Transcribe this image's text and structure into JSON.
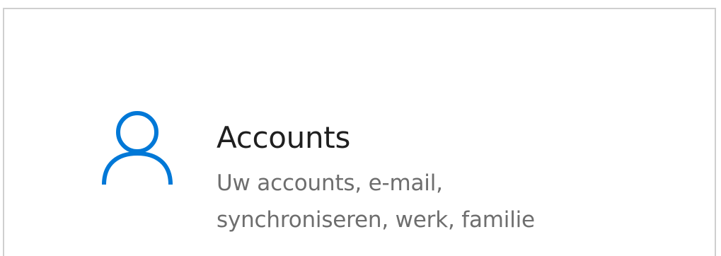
{
  "tile": {
    "title": "Accounts",
    "description": "Uw accounts, e-mail, synchroniseren, werk, familie",
    "icon": "person-icon",
    "accent_color": "#0078d7"
  }
}
